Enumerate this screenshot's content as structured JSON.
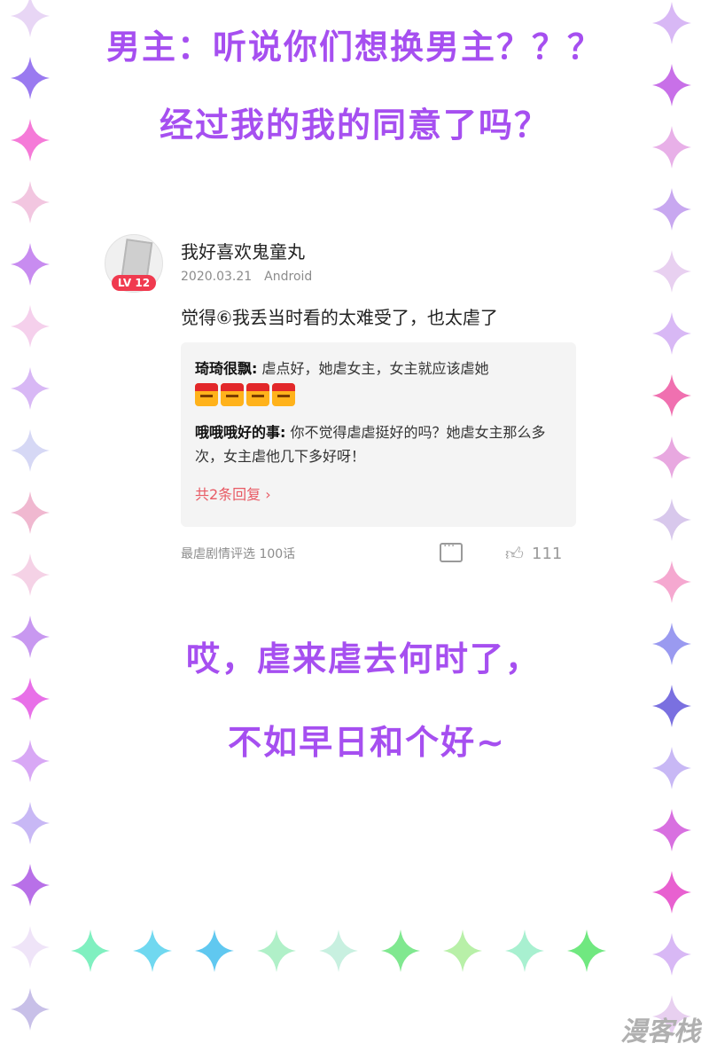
{
  "headlines": {
    "line1": "男主：听说你们想换男主？？？",
    "line2": "经过我的我的同意了吗？",
    "line3": "哎，虐来虐去何时了，",
    "line4": "不如早日和个好~"
  },
  "post": {
    "username": "我好喜欢鬼童丸",
    "level_badge": "LV 12",
    "date": "2020.03.21",
    "platform": "Android",
    "comment": "觉得⑥我丢当时看的太难受了，也太虐了",
    "replies": [
      {
        "nick": "琦琦很飘:",
        "text": " 虐点好，她虐女主，女主就应该虐她",
        "emotes": [
          "给力",
          "给力",
          "给力",
          "给力"
        ]
      },
      {
        "nick": "哦哦哦好的事:",
        "text": " 你不觉得虐虐挺好的吗？她虐女主那么多次，女主虐他几下多好呀！"
      }
    ],
    "more_replies": "共2条回复",
    "episode": "最虐剧情评选  100话",
    "like_count": "111"
  },
  "watermark": "漫客栈",
  "colors": {
    "headline": "#a64ff0",
    "badge": "#f03a4f",
    "more_replies": "#e85a64",
    "reply_bg": "#f4f4f4"
  },
  "icons": [
    "comment-icon",
    "like-icon",
    "star-icon"
  ]
}
